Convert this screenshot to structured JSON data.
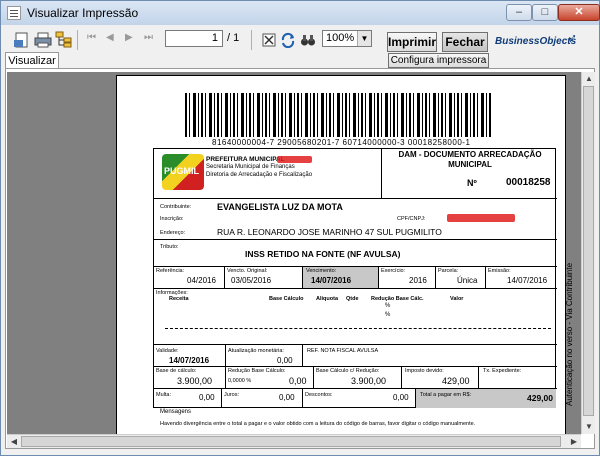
{
  "window": {
    "title": "Visualizar Impressão"
  },
  "toolbar": {
    "page_current": "1",
    "page_total": "/ 1",
    "zoom": "100%",
    "print_label": "Imprimir",
    "close_label": "Fechar",
    "printer_setup_label": "Configura impressora",
    "brand": "BusinessObjects"
  },
  "tab": {
    "label": "Visualizar"
  },
  "doc": {
    "barcode_text": "81640000004-7 29005680201-7 60714000000-3 00018258000-1",
    "prefeitura": "PREFEITURA MUNICIPAL",
    "prefeitura_name_redacted": "DE PUGMIL",
    "secretaria": "Secretaria Municipal de Finanças",
    "diretoria": "Diretoria de Arrecadação e Fiscalização",
    "logo_text": "PUGMIL",
    "dam_title": "DAM - DOCUMENTO ARRECADAÇÃO MUNICIPAL",
    "num_label": "Nº",
    "num_value": "00018258",
    "contribuinte_label": "Contribuinte:",
    "contribuinte_value": "EVANGELISTA LUZ DA MOTA",
    "inscricao_label": "Inscrição:",
    "cpf_label": "CPF/CNPJ:",
    "cpf_value_redacted": "000.000.000-00",
    "endereco_label": "Endereço:",
    "endereco_value": "RUA R. LEONARDO JOSE MARINHO 47 SUL PUGMILITO",
    "tributo_label": "Tributo:",
    "tributo_value": "INSS RETIDO NA FONTE (NF AVULSA)",
    "referencia_label": "Referência:",
    "referencia_value": "04/2016",
    "vencto_label": "Vencto. Original:",
    "vencto_value": "03/05/2016",
    "vencimento_label": "Vencimento:",
    "vencimento_value": "14/07/2016",
    "exercicio_label": "Exercício:",
    "exercicio_value": "2016",
    "parcela_label": "Parcela:",
    "parcela_value": "Única",
    "emissao_label": "Emissão:",
    "emissao_value": "14/07/2016",
    "informacoes_label": "Informações:",
    "cols": [
      "Receita",
      "Base Cálculo",
      "Alíquota",
      "Qtde",
      "Redução Base Cálc.",
      "Valor"
    ],
    "pct1": "%",
    "pct2": "%",
    "validade_label": "Validade:",
    "validade_value": "14/07/2016",
    "atualizacao_label": "Atualização monetária:",
    "atualizacao_value": "0,00",
    "ref_nota": "REF. NOTA FISCAL AVULSA",
    "base_calc_label": "Base de cálculo:",
    "base_calc_value": "3.900,00",
    "reducao_label": "Redução Base Cálculo:",
    "reducao_pct": "0,0000 %",
    "reducao_value": "0,00",
    "base_red_label": "Base Cálculo c/ Redução:",
    "base_red_value": "3.900,00",
    "imposto_label": "Imposto devido:",
    "imposto_value": "429,00",
    "tx_label": "Tx. Expediente:",
    "multa_label": "Multa:",
    "multa_value": "0,00",
    "juros_label": "Juros:",
    "juros_value": "0,00",
    "descontos_label": "Descontos:",
    "descontos_value": "0,00",
    "total_label": "Total a pagar em R$:",
    "total_value": "429,00",
    "mensagens_label": "Mensagens",
    "mensagem": "Havendo divergência entre o total a pagar e o valor obtido com a leitura do código de barras, favor digitar o código manualmente.",
    "side_text": "Autenticação no verso - Via Contribuinte"
  }
}
